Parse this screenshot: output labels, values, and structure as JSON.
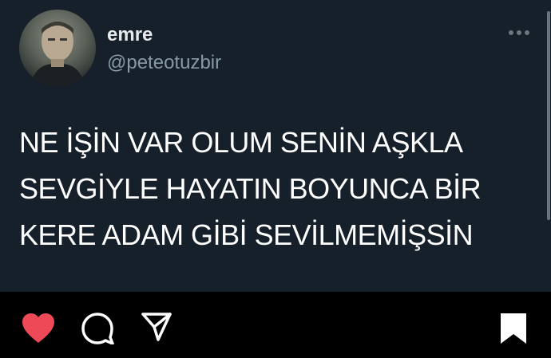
{
  "post": {
    "display_name": "emre",
    "handle": "@peteotuzbir",
    "text_lines": [
      "NE İŞİN VAR OLUM SENİN AŞKLA",
      "SEVGİYLE HAYATIN BOYUNCA BİR",
      "KERE ADAM GİBİ SEVİLMEMİŞSİN"
    ]
  },
  "colors": {
    "card_background": "#15202b",
    "page_background": "#000000",
    "like_active": "#ed4956",
    "text": "#ffffff",
    "handle": "#8899a6"
  },
  "icons": {
    "more": "more-horizontal-icon",
    "like": "heart-icon",
    "comment": "comment-icon",
    "share": "share-paper-plane-icon",
    "save": "bookmark-icon"
  },
  "state": {
    "liked": true,
    "saved": true
  }
}
